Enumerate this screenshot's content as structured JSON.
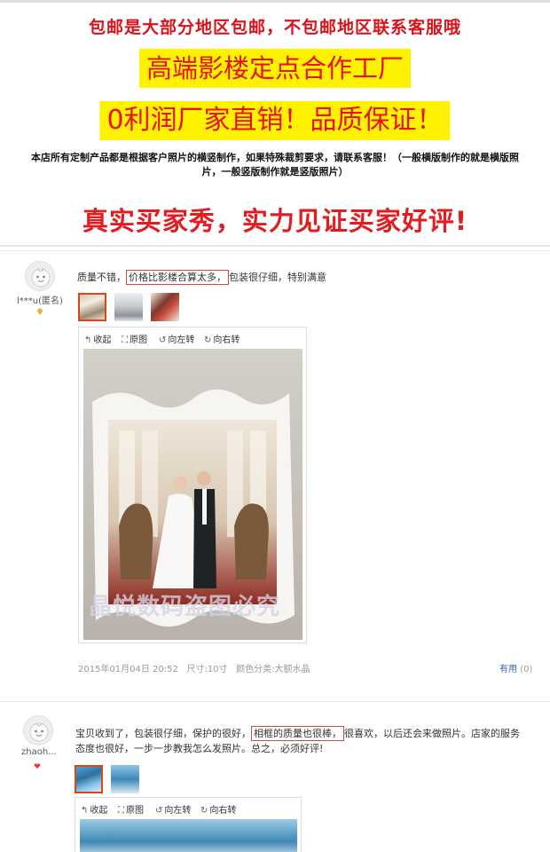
{
  "header": {
    "shipping_notice": "包邮是大部分地区包邮，不包邮地区联系客服哦",
    "banner_1": "高端影楼定点合作工厂",
    "banner_2": "0利润厂家直销！品质保证！",
    "custom_notice_1": "本店所有定制产品都是根据客户照片的横竖制作，如果特殊裁剪要求，请联系客服！（一般横版制作的就是横版照",
    "custom_notice_2": "片，一般竖版制作就是竖版照片）",
    "headline": "真实买家秀，实力见证买家好评!"
  },
  "colors": {
    "banner_bg": "#fff200",
    "accent_red": "#e31c22",
    "thumb_selected": "#d8461c",
    "link_blue": "#3366aa"
  },
  "reviews": [
    {
      "username": "l***u(匿名)",
      "comment_pre": "质量不错，",
      "comment_highlight": "价格比影楼合算太多，",
      "comment_post": "包装很仔细，特别满意",
      "toolbar": {
        "collapse": "收起",
        "original": "原图",
        "rotate_left": "向左转",
        "rotate_right": "向右转"
      },
      "watermark": "晶悦数码盗图必究",
      "date": "2015年01月04日 20:52",
      "size": "尺寸:10寸",
      "color": "颜色分类:大额水晶",
      "useful_label": "有用",
      "useful_count": "(0)"
    },
    {
      "username": "zhaoh...",
      "comment_pre": "宝贝收到了，包装很仔细，保护的很好，",
      "comment_highlight": "相框的质量也很棒，",
      "comment_post": "很喜欢，以后还会来做照片。店家的服务",
      "comment_line2": "态度也很好，一步一步教我怎么发照片。总之，必须好评!",
      "toolbar": {
        "collapse": "收起",
        "original": "原图",
        "rotate_left": "向左转",
        "rotate_right": "向右转"
      }
    }
  ]
}
